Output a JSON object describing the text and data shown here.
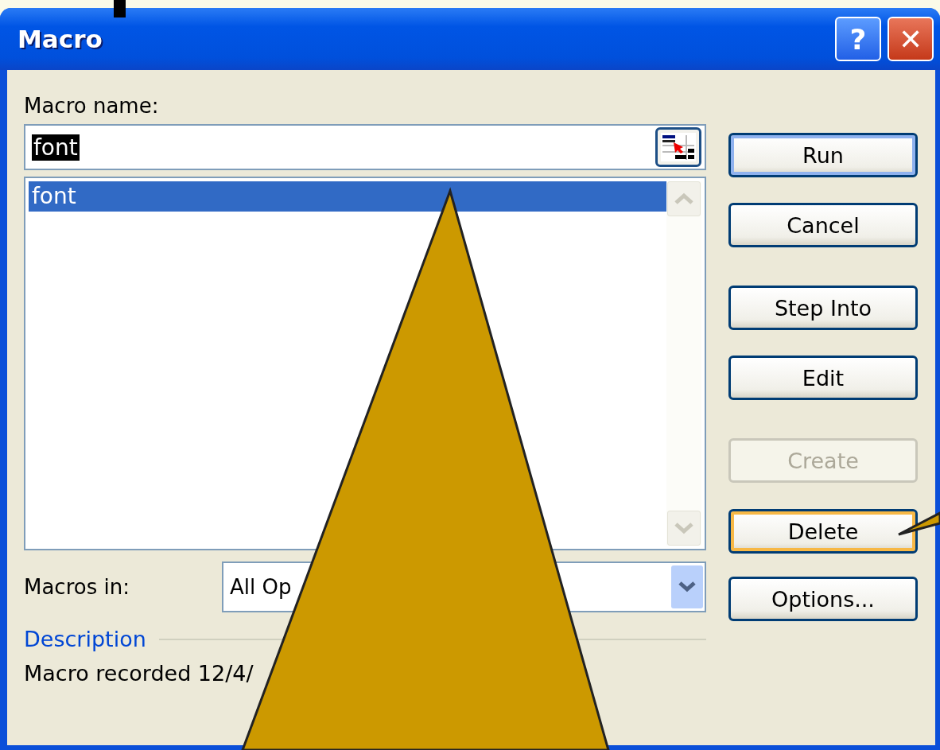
{
  "window": {
    "title": "Macro",
    "buttons": [
      {
        "kind": "help",
        "label": "?"
      },
      {
        "kind": "close",
        "label": "✕"
      }
    ]
  },
  "macro_name": {
    "label": "Macro name:",
    "value": "font",
    "value_selected": true
  },
  "macro_list": {
    "items": [
      {
        "label": "font",
        "selected": true
      }
    ]
  },
  "macros_in": {
    "label": "Macros in:",
    "value": "All Op"
  },
  "description": {
    "heading": "Description",
    "text": "Macro recorded 12/4/"
  },
  "buttons": [
    {
      "label": "Run",
      "disabled": false,
      "default": true,
      "hover": false
    },
    {
      "label": "Cancel",
      "disabled": false,
      "default": false,
      "hover": false
    },
    {
      "label": "Step Into",
      "disabled": false,
      "default": false,
      "hover": false
    },
    {
      "label": "Edit",
      "disabled": false,
      "default": false,
      "hover": false
    },
    {
      "label": "Create",
      "disabled": true,
      "default": false,
      "hover": false
    },
    {
      "label": "Delete",
      "disabled": false,
      "default": false,
      "hover": true
    },
    {
      "label": "Options...",
      "disabled": false,
      "default": false,
      "hover": false
    }
  ]
}
